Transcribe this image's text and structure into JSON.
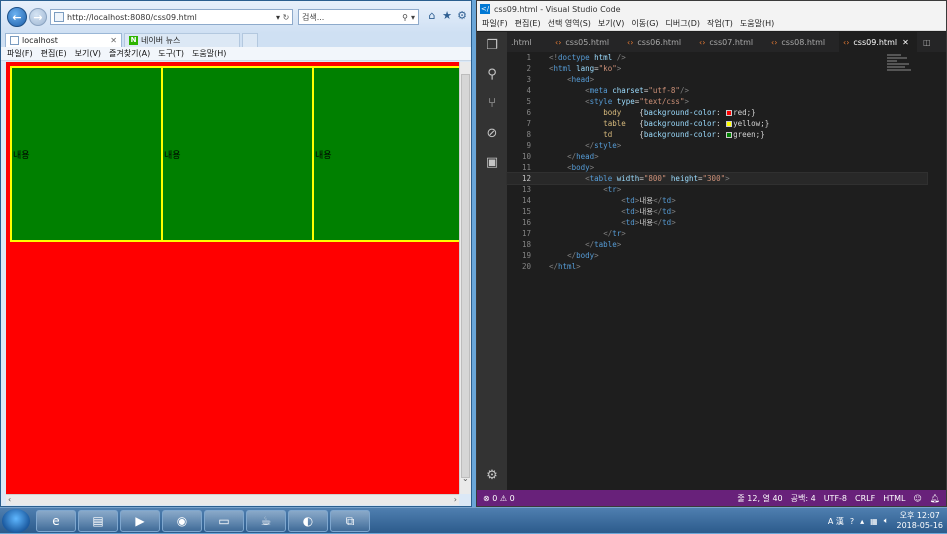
{
  "ie": {
    "address_url": "http://localhost:8080/css09.html",
    "search_placeholder": "검색...",
    "tabs": [
      {
        "label": "localhost"
      },
      {
        "label": "네이버 뉴스"
      }
    ],
    "menu": [
      "파일(F)",
      "편집(E)",
      "보기(V)",
      "즐겨찾기(A)",
      "도구(T)",
      "도움말(H)"
    ],
    "page": {
      "table_cells": [
        "내용",
        "내용",
        "내용"
      ],
      "colors": {
        "body": "#ff0000",
        "table": "#ffff00",
        "td": "#008000"
      }
    }
  },
  "vscode": {
    "title": "css09.html - Visual Studio Code",
    "menu": [
      "파일(F)",
      "편집(E)",
      "선택 영역(S)",
      "보기(V)",
      "이동(G)",
      "디버그(D)",
      "작업(T)",
      "도움말(H)"
    ],
    "tabs": [
      ".html",
      "css05.html",
      "css06.html",
      "css07.html",
      "css08.html",
      "css09.html"
    ],
    "active_tab": "css09.html",
    "code_lines": [
      "<!doctype html />",
      "<html lang=\"ko\">",
      "    <head>",
      "        <meta charset=\"utf-8\"/>",
      "        <style type=\"text/css\">",
      "            body    {background-color: red;}",
      "            table   {background-color: yellow;}",
      "            td      {background-color: green;}",
      "        </style>",
      "    </head>",
      "    <body>",
      "        <table width=\"800\" height=\"300\">",
      "            <tr>",
      "                <td>내용</td>",
      "                <td>내용</td>",
      "                <td>내용</td>",
      "            </tr>",
      "        </table>",
      "    </body>",
      "</html>"
    ],
    "status": {
      "problems": "0",
      "warnings": "0",
      "cursor": "줄 12, 열 40",
      "spaces": "공백: 4",
      "encoding": "UTF-8",
      "eol": "CRLF",
      "language": "HTML"
    }
  },
  "taskbar": {
    "time": "오후 12:07",
    "date": "2018-05-16",
    "ime": "A 漢"
  }
}
